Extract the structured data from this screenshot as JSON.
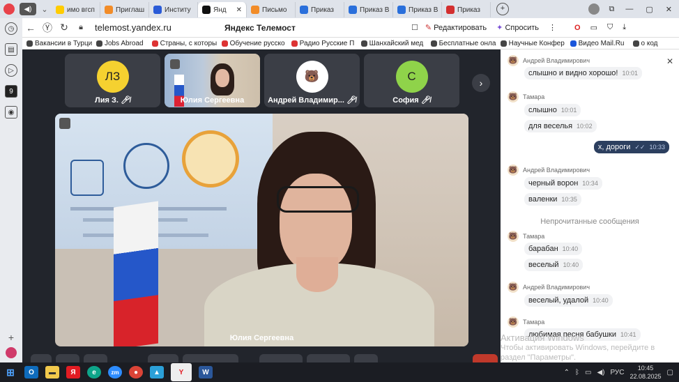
{
  "tabs": [
    {
      "label": "имо вгсп",
      "color": "#ffcc00"
    },
    {
      "label": "Приглаш",
      "color": "#f28c28"
    },
    {
      "label": "Институ",
      "color": "#2a5bd7"
    },
    {
      "label": "Янд",
      "color": "#111111"
    },
    {
      "label": "Письмо",
      "color": "#f28c28"
    },
    {
      "label": "Приказ",
      "color": "#2a6fdb"
    },
    {
      "label": "Приказ В",
      "color": "#2a6fdb"
    },
    {
      "label": "Приказ В",
      "color": "#2a6fdb"
    },
    {
      "label": "Приказ",
      "color": "#d32f2f"
    }
  ],
  "address": {
    "url": "telemost.yandex.ru",
    "page_title": "Яндекс Телемост",
    "edit": "Редактировать",
    "ask": "Спросить"
  },
  "bookmarks": [
    "Вакансии в Турци",
    "Jobs Abroad",
    "Страны, с которы",
    "Обучение русско",
    "Радио Русские П",
    "Шанхайский мед",
    "Бесплатные онла",
    "Научные Конфер",
    "Видео Mail.Ru",
    "о код"
  ],
  "participants": [
    {
      "initials": "ЛЗ",
      "name": "Лия З.",
      "color": "#f5d130"
    },
    {
      "initials": "",
      "name": "Юлия Сергеевна",
      "color": ""
    },
    {
      "initials": "",
      "name": "Андрей Владимир...",
      "color": "#ffffff"
    },
    {
      "initials": "С",
      "name": "София",
      "color": "#8fd34a"
    }
  ],
  "main_video": {
    "speaker": "Юлия Сергеевна"
  },
  "chat": {
    "messages": [
      {
        "author": "Андрей Владимирович",
        "text": "слышно и видно хорошо!",
        "time": "10:01"
      },
      {
        "author": "Тамара",
        "text": "слышно",
        "time": "10:01"
      },
      {
        "author": "",
        "text": "для веселья",
        "time": "10:02"
      },
      {
        "author": "",
        "text": "х, дороги",
        "time": "10:33",
        "own": true
      },
      {
        "author": "Андрей Владимирович",
        "text": "черный ворон",
        "time": "10:34"
      },
      {
        "author": "",
        "text": "валенки",
        "time": "10:35"
      },
      {
        "author": "Тамара",
        "text": "барабан",
        "time": "10:40"
      },
      {
        "author": "",
        "text": "веселый",
        "time": "10:40"
      },
      {
        "author": "Андрей Владимирович",
        "text": "веселый, удалой",
        "time": "10:40"
      },
      {
        "author": "Тамара",
        "text": "любимая песня бабушки",
        "time": "10:41"
      }
    ],
    "unread_label": "Непрочитанные сообщения"
  },
  "watermark": {
    "line1": "Активация Windows",
    "line2": "Чтобы активировать Windows, перейдите в",
    "line3": "раздел \"Параметры\"."
  },
  "taskbar": {
    "language": "РУС",
    "time": "10:45",
    "date": "22.08.2025"
  }
}
